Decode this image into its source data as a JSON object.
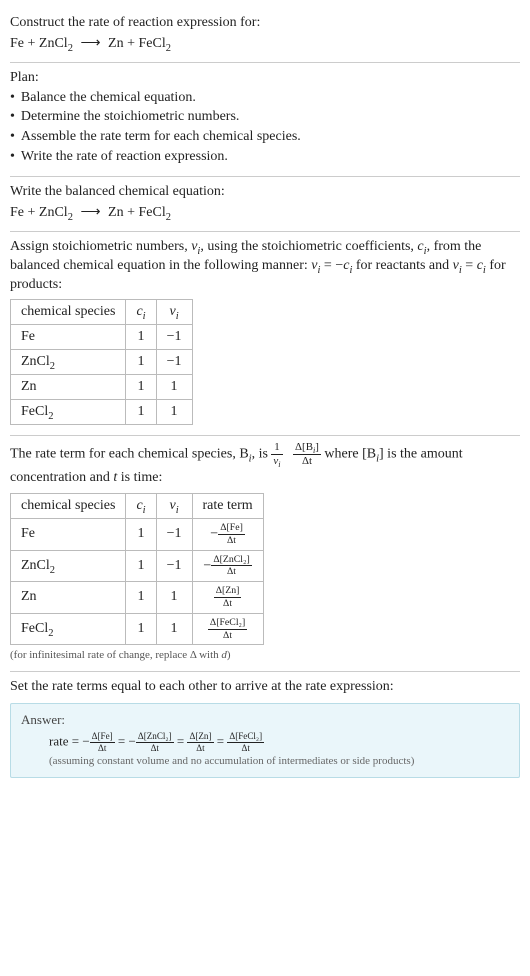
{
  "prompt": {
    "line1": "Construct the rate of reaction expression for:",
    "equation_lhs_a": "Fe",
    "plus": " + ",
    "equation_lhs_b": "ZnCl",
    "sub2": "2",
    "arrow": "⟶",
    "equation_rhs_a": "Zn",
    "equation_rhs_b": "FeCl"
  },
  "plan": {
    "heading": "Plan:",
    "items": [
      "Balance the chemical equation.",
      "Determine the stoichiometric numbers.",
      "Assemble the rate term for each chemical species.",
      "Write the rate of reaction expression."
    ]
  },
  "balanced": {
    "heading": "Write the balanced chemical equation:"
  },
  "assign": {
    "part1": "Assign stoichiometric numbers, ",
    "nu_i": "ν",
    "sub_i": "i",
    "part2": ", using the stoichiometric coefficients, ",
    "c_i": "c",
    "part3": ", from the balanced chemical equation in the following manner: ",
    "eq1_lhs": "ν",
    "eq1_rhs_pre": " = −",
    "for_reactants": " for reactants and ",
    "eq2_rhs_pre": " = ",
    "for_products": " for products:"
  },
  "table1": {
    "headers": [
      "chemical species",
      "cᵢ",
      "νᵢ"
    ],
    "rows": [
      {
        "species": "Fe",
        "c": "1",
        "v": "−1"
      },
      {
        "species": "ZnCl₂",
        "c": "1",
        "v": "−1"
      },
      {
        "species": "Zn",
        "c": "1",
        "v": "1"
      },
      {
        "species": "FeCl₂",
        "c": "1",
        "v": "1"
      }
    ]
  },
  "rateterm": {
    "part1": "The rate term for each chemical species, B",
    "part2": ", is ",
    "one": "1",
    "nu_i": "ν",
    "sub_i": "i",
    "dconc_pre": "Δ[B",
    "dconc_post": "]",
    "dt": "Δt",
    "part3": " where [B",
    "part4": "] is the amount concentration and ",
    "t": "t",
    "part5": " is time:"
  },
  "table2": {
    "headers": [
      "chemical species",
      "cᵢ",
      "νᵢ",
      "rate term"
    ],
    "rows": [
      {
        "species": "Fe",
        "c": "1",
        "v": "−1",
        "num": "Δ[Fe]",
        "neg": "−"
      },
      {
        "species": "ZnCl₂",
        "c": "1",
        "v": "−1",
        "num": "Δ[ZnCl₂]",
        "neg": "−"
      },
      {
        "species": "Zn",
        "c": "1",
        "v": "1",
        "num": "Δ[Zn]",
        "neg": ""
      },
      {
        "species": "FeCl₂",
        "c": "1",
        "v": "1",
        "num": "Δ[FeCl₂]",
        "neg": ""
      }
    ],
    "dt": "Δt",
    "note": "(for infinitesimal rate of change, replace Δ with d)"
  },
  "final": {
    "heading": "Set the rate terms equal to each other to arrive at the rate expression:"
  },
  "answer": {
    "label": "Answer:",
    "rate": "rate",
    "eq": " = ",
    "neg": "−",
    "terms": [
      {
        "num": "Δ[Fe]",
        "neg": "−"
      },
      {
        "num": "Δ[ZnCl₂]",
        "neg": "−"
      },
      {
        "num": "Δ[Zn]",
        "neg": ""
      },
      {
        "num": "Δ[FeCl₂]",
        "neg": ""
      }
    ],
    "dt": "Δt",
    "assuming": "(assuming constant volume and no accumulation of intermediates or side products)"
  }
}
